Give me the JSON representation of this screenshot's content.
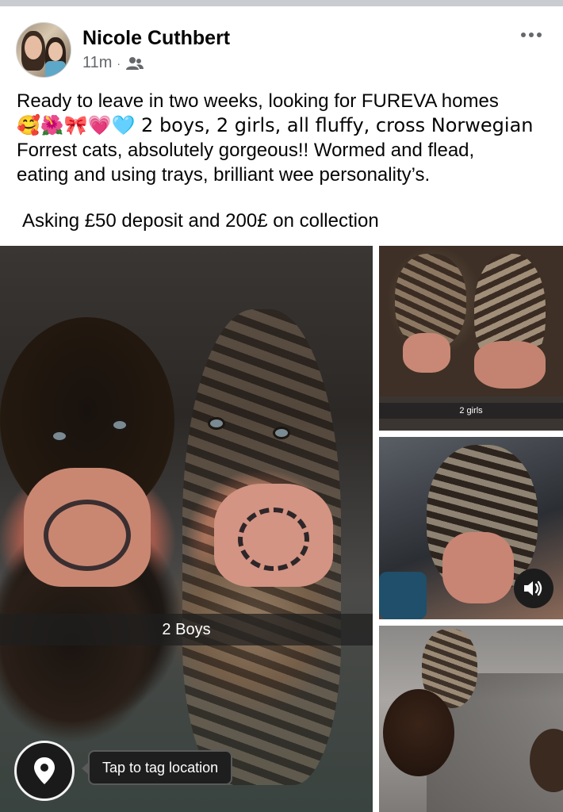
{
  "post": {
    "author": "Nicole Cuthbert",
    "time": "11m",
    "separator": "·",
    "audience_icon": "friends-icon",
    "more_icon": "more-horizontal-icon",
    "text_lines": [
      "Ready to leave in two weeks, looking for FUREVA homes",
      "🥰🌺🎀💗🩵 2 boys, 2 girls, all fluffy, cross Norwegian",
      "Forrest cats, absolutely gorgeous!! Wormed and flead,",
      "eating and using trays, brilliant wee personality’s."
    ],
    "asking": "Asking £50 deposit and 200£ on collection"
  },
  "photos": {
    "main_caption": "2 Boys",
    "top_right_caption": "2 girls",
    "sound_icon": "speaker-icon",
    "location_icon": "location-pin-icon",
    "tag_location_label": "Tap to tag location"
  }
}
